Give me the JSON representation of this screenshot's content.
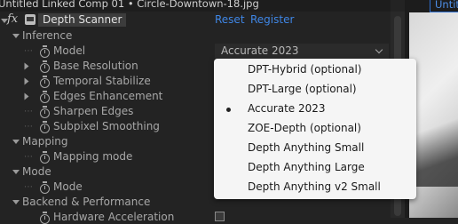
{
  "header": {
    "title": "Untitled Linked Comp 01 • Circle-Downtown-18.jpg",
    "right_tab": "Untit"
  },
  "effect": {
    "fx_label": "fx",
    "name": "Depth Scanner",
    "reset_label": "Reset",
    "register_label": "Register"
  },
  "groups": {
    "inference": "Inference",
    "mapping": "Mapping",
    "mode": "Mode",
    "backend": "Backend & Performance"
  },
  "props": {
    "model": "Model",
    "base_resolution": "Base Resolution",
    "temporal_stabilize": "Temporal Stabilize",
    "edges_enhancement": "Edges Enhancement",
    "sharpen_edges": "Sharpen Edges",
    "subpixel_smoothing": "Subpixel Smoothing",
    "mapping_mode": "Mapping mode",
    "mode": "Mode",
    "hardware_acceleration": "Hardware Acceleration"
  },
  "model_select": {
    "value": "Accurate 2023"
  },
  "dropdown": {
    "options": [
      "DPT-Hybrid (optional)",
      "DPT-Large (optional)",
      "Accurate 2023",
      "ZOE-Depth (optional)",
      "Depth Anything Small",
      "Depth Anything Large",
      "Depth Anything v2 Small"
    ],
    "selected": "Accurate 2023"
  },
  "colors": {
    "accent": "#3f86e5",
    "panel_bg": "#232323",
    "menu_bg": "#f5f5f5"
  }
}
